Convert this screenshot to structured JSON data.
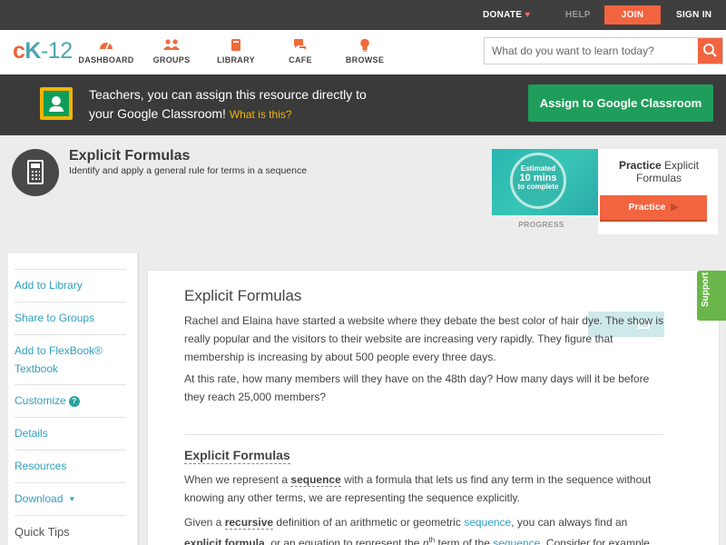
{
  "topbar": {
    "donate": "DONATE",
    "help": "HELP",
    "join": "JOIN",
    "signin": "SIGN IN"
  },
  "brand": {
    "c": "c",
    "k": "K",
    "num": "-12"
  },
  "nav": {
    "dashboard": "DASHBOARD",
    "groups": "GROUPS",
    "library": "LIBRARY",
    "cafe": "CAFE",
    "browse": "BROWSE"
  },
  "search": {
    "placeholder": "What do you want to learn today?"
  },
  "classroom": {
    "line1": "Teachers, you can assign this resource directly to",
    "line2": "your Google Classroom!",
    "what": "What is this?",
    "button": "Assign to Google Classroom"
  },
  "header": {
    "title": "Explicit Formulas",
    "subtitle": "Identify and apply a general rule for terms in a sequence"
  },
  "practice": {
    "estimated": "Estimated",
    "mins": "10 mins",
    "complete": "to complete",
    "progress": "PROGRESS",
    "title_bold": "Practice",
    "title_rest": "Explicit Formulas",
    "button": "Practice"
  },
  "sidebar": {
    "add_library": "Add to Library",
    "share_groups": "Share to Groups",
    "add_flexbook_1": "Add to FlexBook®",
    "add_flexbook_2": "Textbook",
    "customize": "Customize",
    "details": "Details",
    "resources": "Resources",
    "download": "Download",
    "quick_tips": "Quick Tips"
  },
  "article": {
    "title": "Explicit Formulas",
    "p1": "Rachel and Elaina have started a website where they debate the best color of hair dye. The show is really popular and the visitors to their website are increasing very rapidly. They figure that membership is increasing by about 500 people every three days.",
    "p2": "At this rate, how many members will they have on the 48th day? How many days will it be before they reach 25,000 members?",
    "h2": "Explicit Formulas",
    "p3_a": "When we represent a ",
    "p3_term": "sequence",
    "p3_b": " with a formula that lets us find any term in the sequence without knowing any other terms, we are representing the sequence explicitly.",
    "p4_a": "Given a ",
    "p4_term": "recursive",
    "p4_b": " definition of an arithmetic or geometric ",
    "p4_link1": "sequence",
    "p4_c": ", you can always find an ",
    "p4_term2": "explicit formula",
    "p4_d": ", or an equation to represent the ",
    "p4_n": "n",
    "p4_th": "th",
    "p4_e": " term of the ",
    "p4_link2": "sequence",
    "p4_f": ". Consider for example"
  },
  "support": "Support"
}
